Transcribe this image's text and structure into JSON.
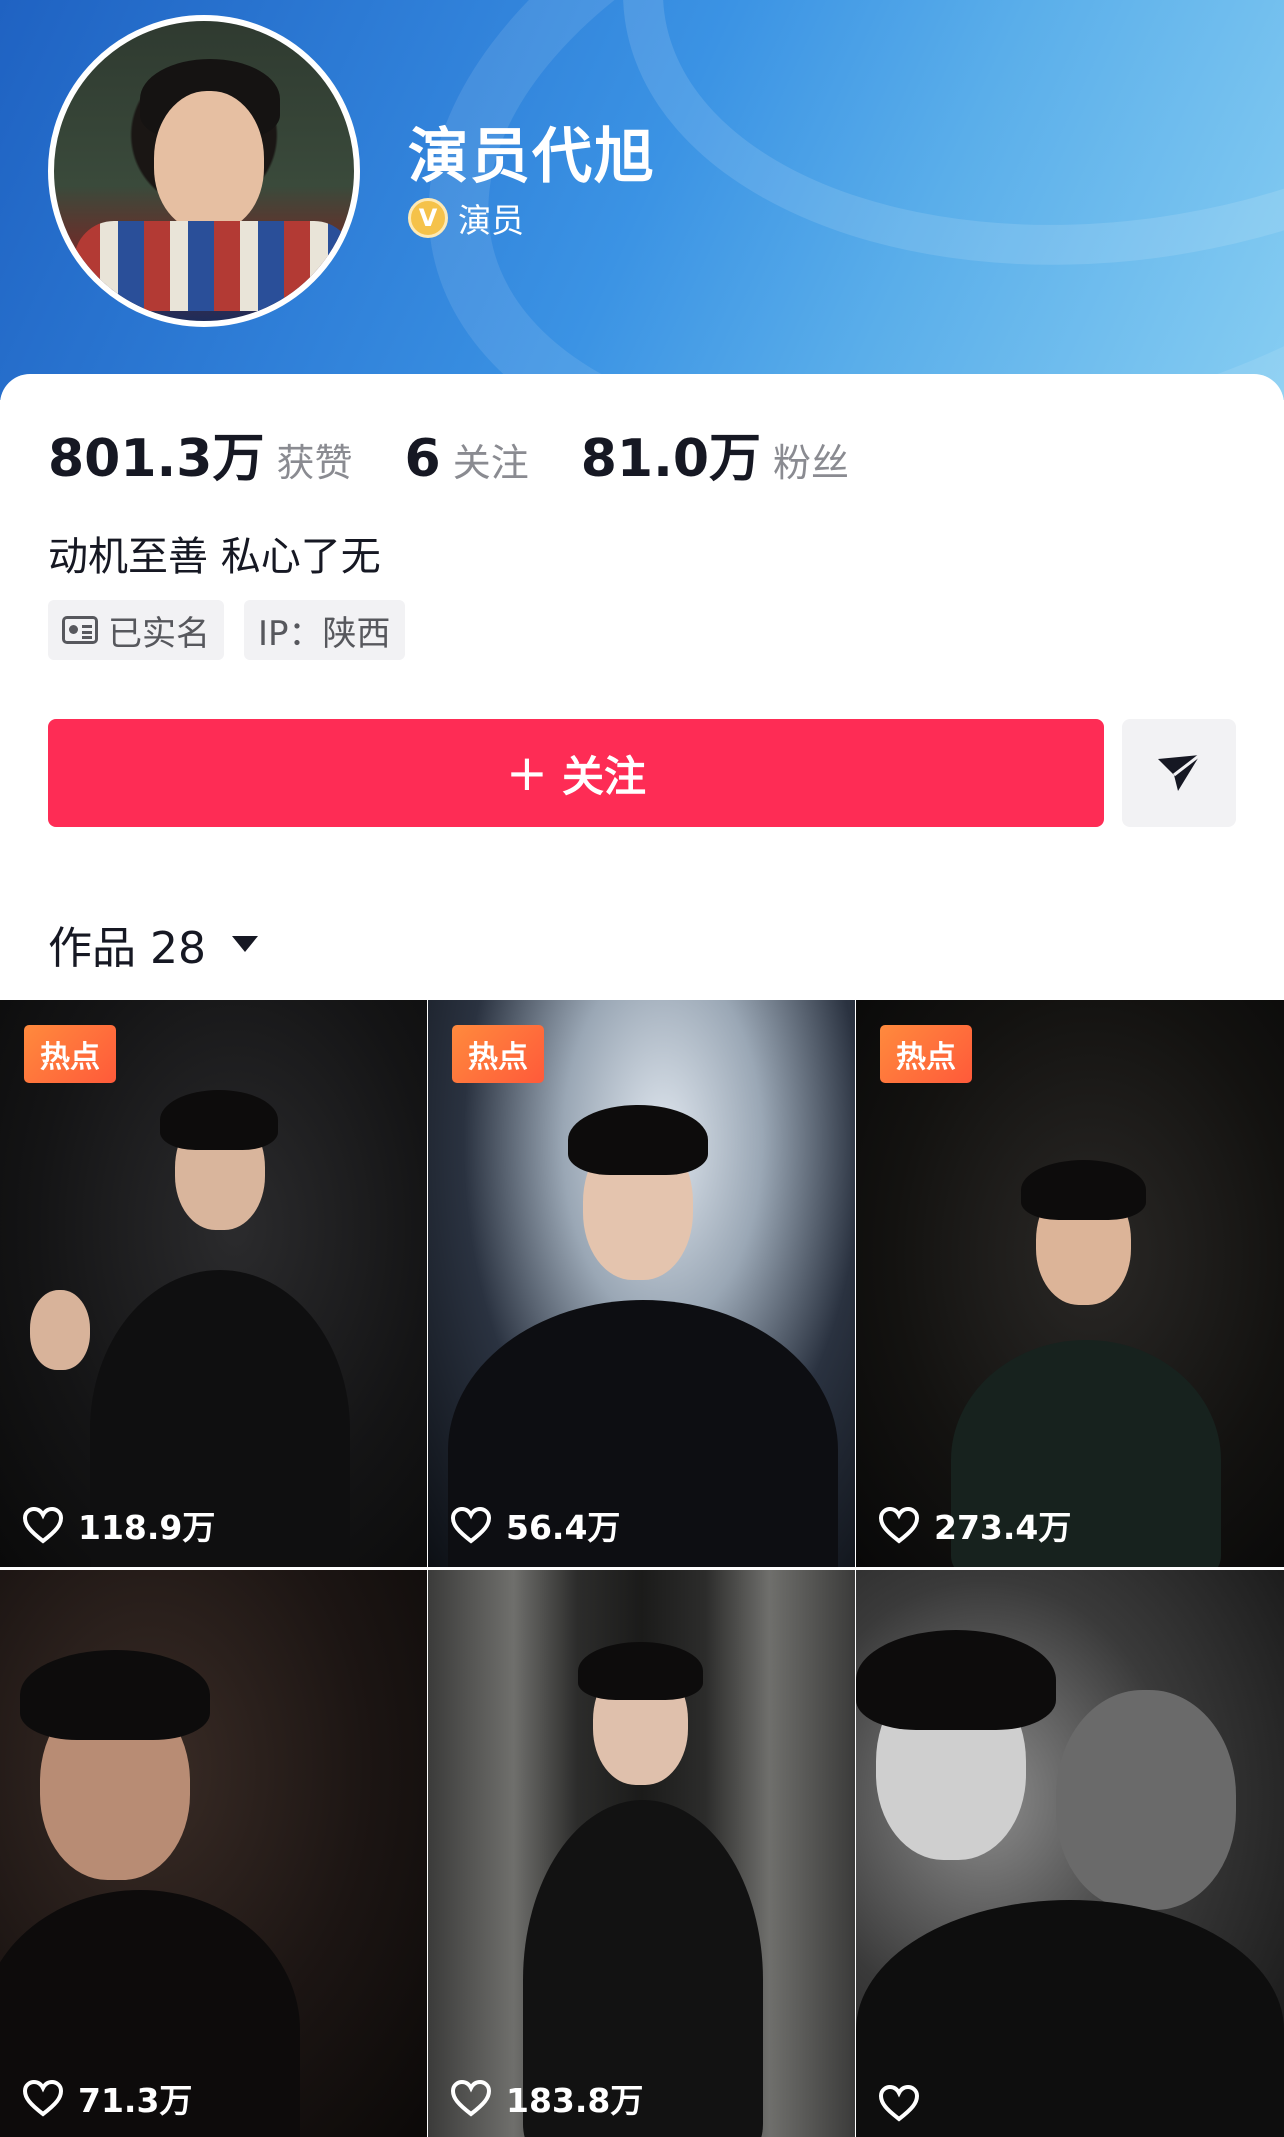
{
  "profile": {
    "name": "演员代旭",
    "verify_badge": "V",
    "verify_label": "演员"
  },
  "stats": [
    {
      "value": "801.3万",
      "label": "获赞"
    },
    {
      "value": "6",
      "label": "关注"
    },
    {
      "value": "81.0万",
      "label": "粉丝"
    }
  ],
  "bio": "动机至善 私心了无",
  "tags": {
    "realname": "已实名",
    "ip": "IP：陕西"
  },
  "actions": {
    "follow_plus": "+",
    "follow_label": "关注",
    "share_icon": "send-icon"
  },
  "works": {
    "label": "作品 28"
  },
  "videos": [
    {
      "likes": "118.9万",
      "hot_label": "热点",
      "hot": true
    },
    {
      "likes": "56.4万",
      "hot_label": "热点",
      "hot": true
    },
    {
      "likes": "273.4万",
      "hot_label": "热点",
      "hot": true
    },
    {
      "likes": "71.3万",
      "hot": false
    },
    {
      "likes": "183.8万",
      "hot": false
    },
    {
      "likes": "",
      "hot": false
    }
  ],
  "colors": {
    "accent": "#fe2c55",
    "hot_badge": "#ff6b3a",
    "header_start": "#1f62c2",
    "header_end": "#86cdf2"
  }
}
